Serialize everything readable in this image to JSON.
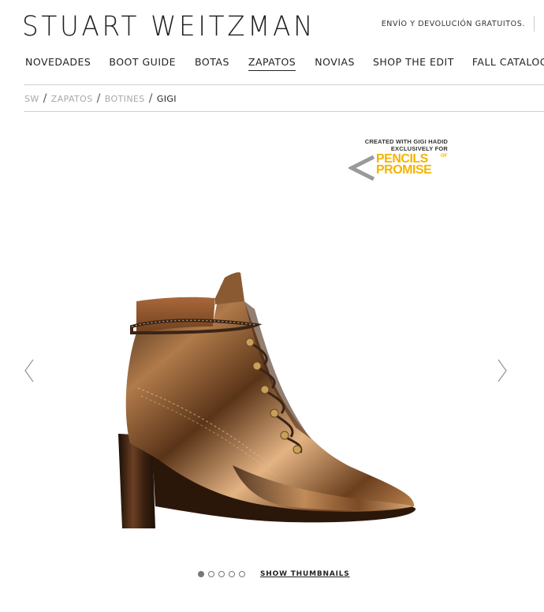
{
  "header": {
    "brand": "STUART WEITZMAN",
    "shipping_note": "ENVÍO Y DEVOLUCIÓN GRATUITOS."
  },
  "nav": [
    {
      "label": "NOVEDADES",
      "active": false
    },
    {
      "label": "BOOT GUIDE",
      "active": false
    },
    {
      "label": "BOTAS",
      "active": false
    },
    {
      "label": "ZAPATOS",
      "active": true
    },
    {
      "label": "NOVIAS",
      "active": false
    },
    {
      "label": "SHOP THE EDIT",
      "active": false
    },
    {
      "label": "FALL CATALOG",
      "active": false
    }
  ],
  "breadcrumb": {
    "items": [
      "SW",
      "ZAPATOS",
      "BOTINES"
    ],
    "current": "GIGI",
    "separator": "/"
  },
  "promo": {
    "line1": "CREATED WITH GIGI HADID",
    "line2": "EXCLUSIVELY FOR",
    "brand_line1": "PENCILS",
    "brand_line2": "PROMISE",
    "brand_of": "OF",
    "brand_color": "#f4b400",
    "chevron_color": "#9a9a9a"
  },
  "gallery": {
    "prev_icon": "chevron-left-icon",
    "next_icon": "chevron-right-icon",
    "dots_total": 5,
    "active_dot": 0,
    "show_thumbnails_label": "SHOW THUMBNAILS"
  },
  "product": {
    "image": "bronze metallic lace-up ankle boot with block heel"
  },
  "colors": {
    "text": "#222222",
    "muted": "#a8a8a8",
    "rule": "#cfcfcf",
    "bronze_dark": "#3b2414",
    "bronze_mid": "#8a5a33",
    "bronze_light": "#d9a272"
  }
}
